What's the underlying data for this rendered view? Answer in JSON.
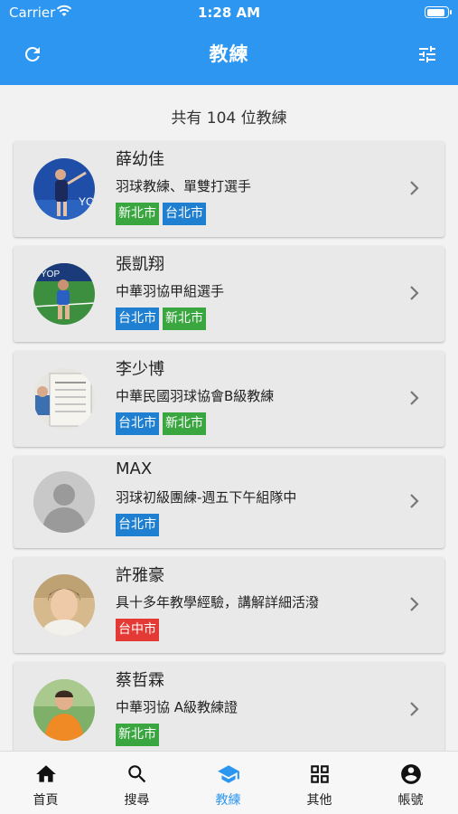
{
  "status_bar": {
    "carrier": "Carrier",
    "time": "1:28 AM"
  },
  "header": {
    "title": "教練"
  },
  "count_text": "共有 104 位教練",
  "coaches": [
    {
      "name": "薛幼佳",
      "desc": "羽球教練、單雙打選手",
      "tags": [
        {
          "label": "新北市",
          "color": "#3aa63f"
        },
        {
          "label": "台北市",
          "color": "#1f7fd0"
        }
      ]
    },
    {
      "name": "張凱翔",
      "desc": "中華羽協甲組選手",
      "tags": [
        {
          "label": "台北市",
          "color": "#1f7fd0"
        },
        {
          "label": "新北市",
          "color": "#3aa63f"
        }
      ]
    },
    {
      "name": "李少博",
      "desc": "中華民國羽球協會B級教練",
      "tags": [
        {
          "label": "台北市",
          "color": "#1f7fd0"
        },
        {
          "label": "新北市",
          "color": "#3aa63f"
        }
      ]
    },
    {
      "name": "MAX",
      "desc": "羽球初級團練-週五下午組隊中",
      "tags": [
        {
          "label": "台北市",
          "color": "#1f7fd0"
        }
      ]
    },
    {
      "name": "許雅豪",
      "desc": "具十多年教學經驗，講解詳細活潑",
      "tags": [
        {
          "label": "台中市",
          "color": "#e53935"
        }
      ]
    },
    {
      "name": "蔡哲霖",
      "desc": "中華羽協 A級教練證",
      "tags": [
        {
          "label": "新北市",
          "color": "#3aa63f"
        }
      ]
    }
  ],
  "tabs": [
    {
      "label": "首頁",
      "icon": "home-icon"
    },
    {
      "label": "搜尋",
      "icon": "search-icon"
    },
    {
      "label": "教練",
      "icon": "graduation-cap-icon"
    },
    {
      "label": "其他",
      "icon": "grid-icon"
    },
    {
      "label": "帳號",
      "icon": "account-circle-icon"
    }
  ],
  "colors": {
    "primary": "#2d96f0",
    "tag_green": "#3aa63f",
    "tag_blue": "#1f7fd0",
    "tag_red": "#e53935"
  }
}
